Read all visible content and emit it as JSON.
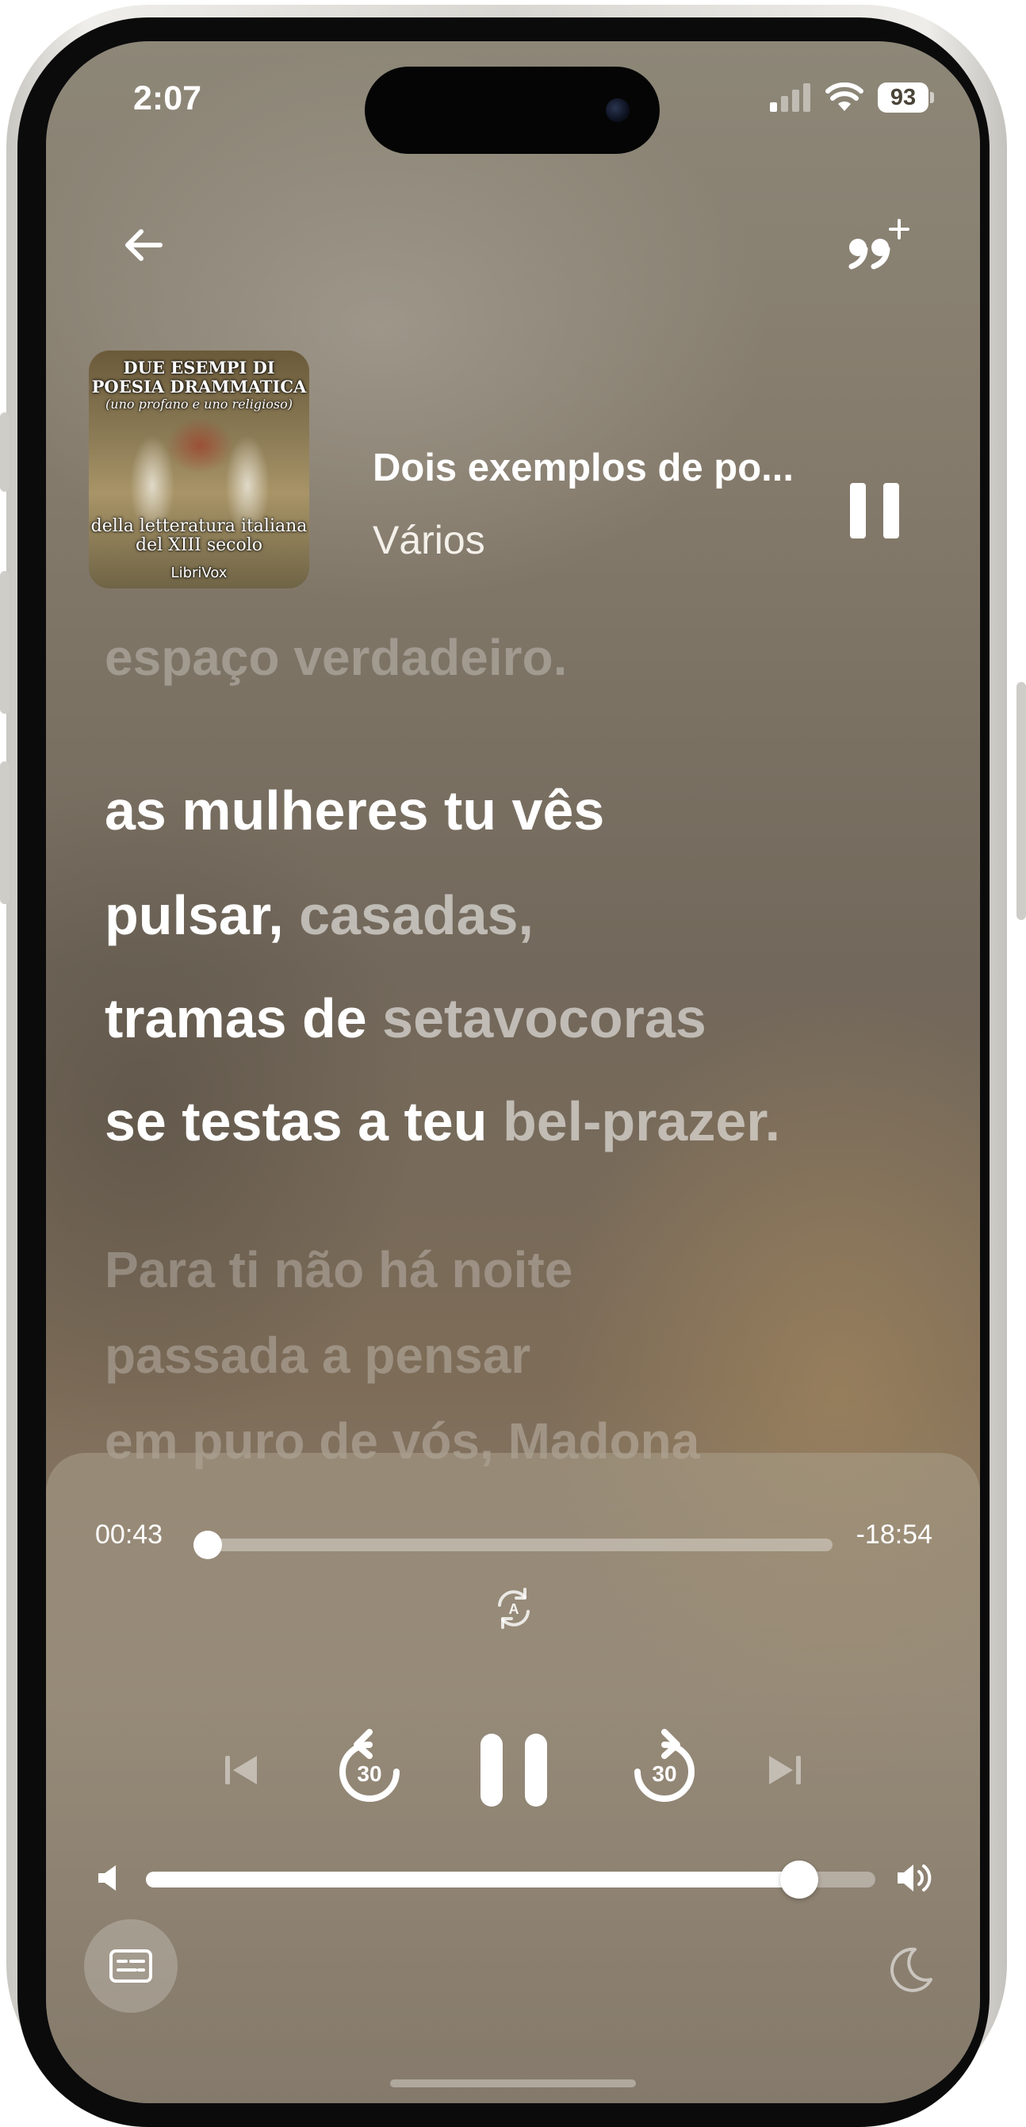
{
  "status_bar": {
    "time": "2:07",
    "battery": "93"
  },
  "header": {
    "back_label": "Back",
    "quote_label": "Add quote"
  },
  "now_playing": {
    "title": "Dois exemplos de po...",
    "artist": "Vários",
    "cover": {
      "top_text": "DUE ESEMPI DI POESIA DRAMMATICA",
      "sub_text": "(uno profano e uno religioso)",
      "bottom_text": "della letteratura italiana del XIII secolo",
      "brand": "LibriVox"
    }
  },
  "lyrics": {
    "previous": "espaço verdadeiro.",
    "active": [
      {
        "sung": "as mulheres tu vês",
        "rest": ""
      },
      {
        "sung": "pulsar, ",
        "rest": "casadas,"
      },
      {
        "sung": "tramas de ",
        "rest": "setavocoras"
      },
      {
        "sung": "se testas a teu ",
        "rest": "bel-prazer."
      }
    ],
    "next": [
      "Para ti não há noite",
      "passada a pensar",
      "em puro de vós, Madona"
    ]
  },
  "player": {
    "elapsed": "00:43",
    "remaining": "-18:54",
    "progress": 0.022,
    "volume": 0.896,
    "skip_back_seconds": "30",
    "skip_forward_seconds": "30",
    "autoplay_letter": "A"
  },
  "icons": {
    "back": "arrow-left-icon",
    "quote": "quote-plus-icon",
    "pause": "pause-icon",
    "previous": "skip-previous-icon",
    "rewind": "rewind-30-icon",
    "forward": "forward-30-icon",
    "next": "skip-next-icon",
    "volume_low": "volume-low-icon",
    "volume_high": "volume-high-icon",
    "lyrics": "lyrics-icon",
    "sleep": "moon-icon",
    "autoplay": "autoplay-icon"
  }
}
